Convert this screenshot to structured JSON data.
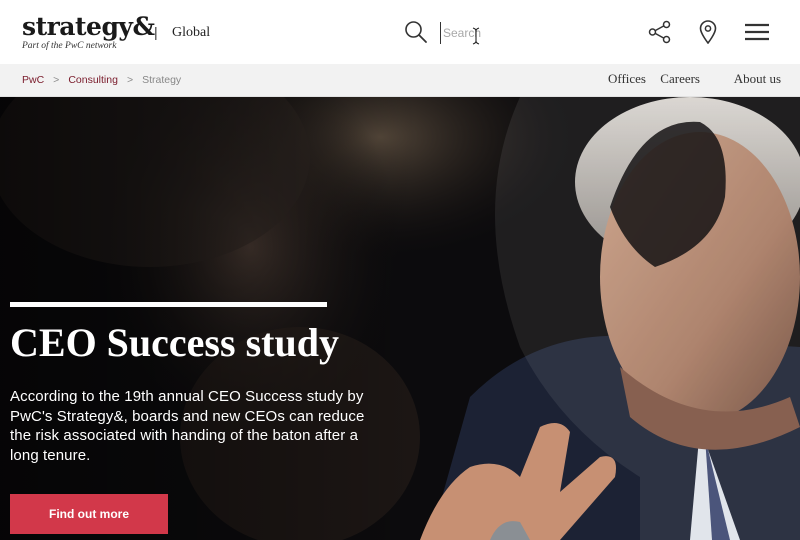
{
  "header": {
    "logo_text": "strategy&",
    "logo_tagline": "Part of the PwC network",
    "separator": "|",
    "region": "Global",
    "search_placeholder": "Search"
  },
  "breadcrumb": {
    "items": [
      "PwC",
      "Consulting",
      "Strategy"
    ],
    "separator": ">"
  },
  "topnav": {
    "items": [
      "Offices",
      "Careers",
      "About us"
    ]
  },
  "hero": {
    "title": "CEO Success study",
    "text": "According to the 19th annual CEO Success study by PwC's Strategy&, boards and new CEOs can reduce the risk associated with handing of the baton after a long tenure.",
    "cta_label": "Find out more"
  },
  "colors": {
    "brand_red": "#d2384a",
    "breadcrumb_link": "#7a1b2b",
    "hero_bg": "#0b0b0d"
  },
  "icons": [
    "search-icon",
    "share-icon",
    "location-icon",
    "menu-icon"
  ]
}
